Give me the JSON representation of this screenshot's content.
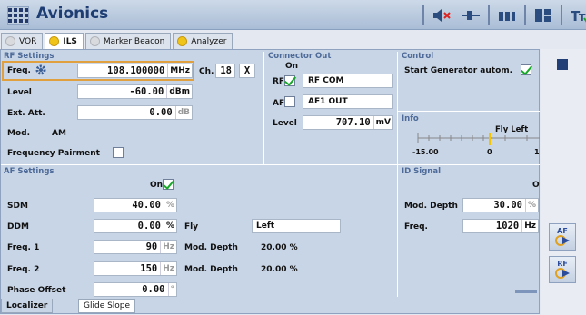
{
  "app": {
    "title": "Avionics"
  },
  "tabs": [
    {
      "label": "VOR",
      "active": false
    },
    {
      "label": "ILS",
      "active": true
    },
    {
      "label": "Marker Beacon",
      "active": false
    },
    {
      "label": "Analyzer",
      "active": true
    }
  ],
  "rf": {
    "header": "RF Settings",
    "freq_label": "Freq.",
    "freq_value": "108.100000",
    "freq_unit": "MHz",
    "ch_label": "Ch.",
    "ch_value": "18",
    "ch_suffix": "X",
    "level_label": "Level",
    "level_value": "-60.00",
    "level_unit": "dBm",
    "extatt_label": "Ext. Att.",
    "extatt_value": "0.00",
    "extatt_unit": "dB",
    "mod_label": "Mod.",
    "mod_value": "AM",
    "pair_label": "Frequency Pairment"
  },
  "connector": {
    "header": "Connector Out",
    "on_label": "On",
    "rf_label": "RF",
    "rf_value": "RF COM",
    "af_label": "AF",
    "af_value": "AF1 OUT",
    "level_label": "Level",
    "level_value": "707.10",
    "level_unit": "mV"
  },
  "control": {
    "header": "Control",
    "start_label": "Start Generator autom."
  },
  "info": {
    "header": "Info",
    "fly_label": "Fly Left",
    "scale_left": "-15.00",
    "scale_mid": "0",
    "scale_right": "1"
  },
  "af": {
    "header": "AF Settings",
    "on_label": "On",
    "sdm_label": "SDM",
    "sdm_value": "40.00",
    "sdm_unit": "%",
    "ddm_label": "DDM",
    "ddm_value": "0.00",
    "ddm_unit": "%",
    "fly_label": "Fly",
    "fly_value": "Left",
    "f1_label": "Freq. 1",
    "f1_value": "90",
    "f1_unit": "Hz",
    "md1_label": "Mod. Depth",
    "md1_value": "20.00 %",
    "f2_label": "Freq. 2",
    "f2_value": "150",
    "f2_unit": "Hz",
    "md2_label": "Mod. Depth",
    "md2_value": "20.00 %",
    "po_label": "Phase Offset",
    "po_value": "0.00",
    "po_unit": "°"
  },
  "id": {
    "header": "ID Signal",
    "on_label": "O",
    "md_label": "Mod. Depth",
    "md_value": "30.00",
    "md_unit": "%",
    "freq_label": "Freq.",
    "freq_value": "1020",
    "freq_unit": "Hz"
  },
  "bottom": {
    "tab1": "Localizer",
    "tab2": "Glide Slope"
  },
  "side": {
    "af_btn": "AF",
    "rf_btn": "RF"
  }
}
